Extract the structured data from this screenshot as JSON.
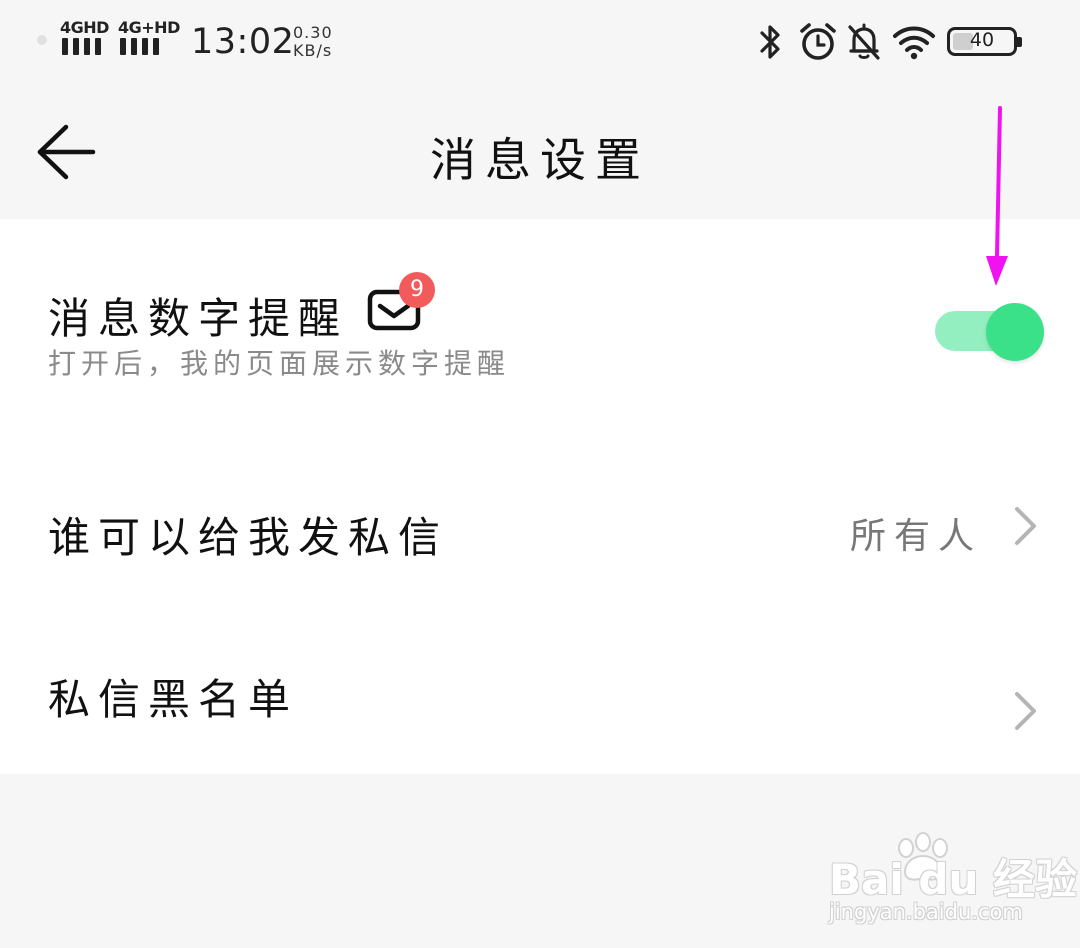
{
  "status_bar": {
    "network_1": "4GHD",
    "network_2": "4G+HD",
    "time": "13:02",
    "speed_value": "0.30",
    "speed_unit": "KB/s",
    "battery_percent": "40",
    "battery_level": 0.4,
    "icons": [
      "bluetooth-icon",
      "alarm-icon",
      "bell-muted-icon",
      "wifi-icon",
      "battery-icon"
    ]
  },
  "header": {
    "title": "消息设置"
  },
  "settings": {
    "rows": [
      {
        "title": "消息数字提醒",
        "subtitle": "打开后，我的页面展示数字提醒",
        "badge_count": "9",
        "toggle_on": true
      },
      {
        "title": "谁可以给我发私信",
        "value": "所有人"
      },
      {
        "title": "私信黑名单"
      }
    ]
  },
  "watermark": {
    "brand": "Bai du 经验",
    "url": "jingyan.baidu.com"
  },
  "colors": {
    "background": "#f6f6f6",
    "card": "#ffffff",
    "toggle_track": "#93efc0",
    "toggle_knob": "#3ae189",
    "badge": "#f25b5b",
    "annotation_arrow": "#f012f0"
  }
}
